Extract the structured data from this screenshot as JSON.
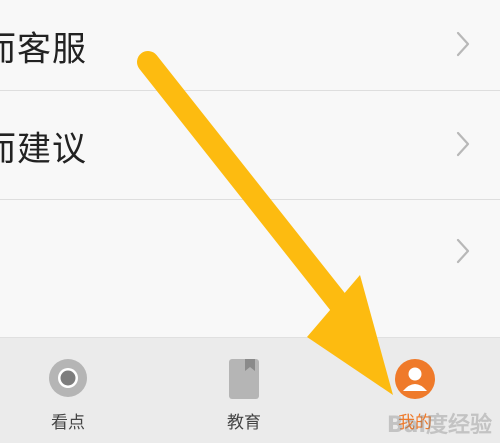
{
  "menu": {
    "items": [
      {
        "label": "而客服"
      },
      {
        "label": "而建议"
      },
      {
        "label": ""
      }
    ]
  },
  "tabbar": {
    "tabs": [
      {
        "label": "看点",
        "icon": "camera-icon",
        "active": false
      },
      {
        "label": "教育",
        "icon": "book-icon",
        "active": false
      },
      {
        "label": "我的",
        "icon": "user-icon",
        "active": true
      }
    ]
  },
  "colors": {
    "accent": "#ef7a2a",
    "arrow": "#fdbb10",
    "background": "#f8f8f8",
    "tabbar_bg": "#ebebeb"
  },
  "watermark": "Bai度经验"
}
